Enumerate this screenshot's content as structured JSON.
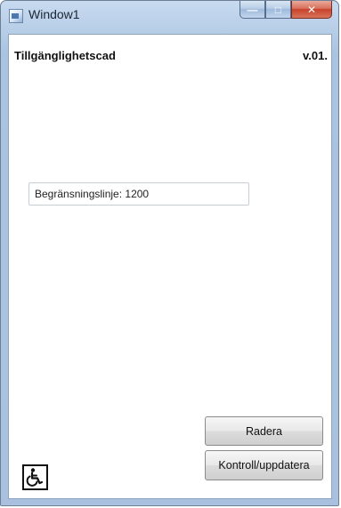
{
  "window": {
    "title": "Window1",
    "controls": {
      "minimize": "—",
      "maximize": "□",
      "close": "✕"
    }
  },
  "header": {
    "app_name": "Tillgänglighetscad",
    "version": "v.01."
  },
  "field": {
    "limit_line": "Begränsningslinje: 1200"
  },
  "buttons": {
    "delete": "Radera",
    "check_update": "Kontroll/uppdatera"
  },
  "icons": {
    "window_icon": "app-window-icon",
    "accessibility": "wheelchair-icon"
  },
  "colors": {
    "frame": "#b9cfe8",
    "close_button": "#c7432a"
  }
}
